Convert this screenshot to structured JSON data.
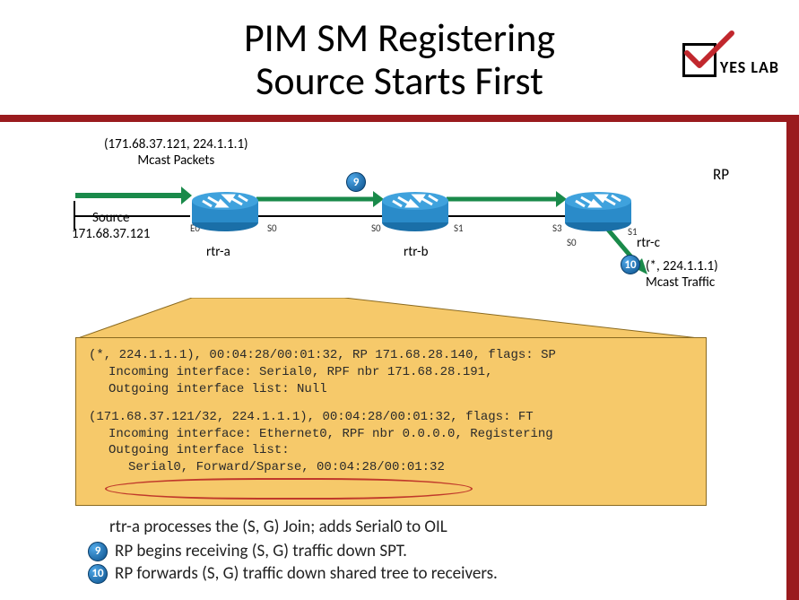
{
  "title_line1": "PIM SM Registering",
  "title_line2": "Source Starts First",
  "logo_text": "YES LAB",
  "diagram": {
    "packets_label_line1": "(171.68.37.121, 224.1.1.1)",
    "packets_label_line2": "Mcast Packets",
    "source_label_line1": "Source",
    "source_label_line2": "171.68.37.121",
    "rp_label": "RP",
    "rtr_a": "rtr-a",
    "rtr_b": "rtr-b",
    "rtr_c": "rtr-c",
    "mcast_label_line1": "(*, 224.1.1.1)",
    "mcast_label_line2": "Mcast Traffic",
    "iface_e0": "E0",
    "iface_s0a": "S0",
    "iface_s0b": "S0",
    "iface_s1b": "S1",
    "iface_s3c": "S3",
    "iface_s0c": "S0",
    "iface_s1c": "S1",
    "num9": "9",
    "num10": "10"
  },
  "cli": {
    "l1": "(*, 224.1.1.1), 00:04:28/00:01:32, RP 171.68.28.140, flags: SP",
    "l2": "Incoming interface: Serial0, RPF nbr 171.68.28.191,",
    "l3": "Outgoing interface list: Null",
    "l4": "(171.68.37.121/32, 224.1.1.1), 00:04:28/00:01:32, flags: FT",
    "l5": "Incoming interface: Ethernet0, RPF nbr 0.0.0.0, Registering",
    "l6": "Outgoing interface list:",
    "l7": "Serial0, Forward/Sparse, 00:04:28/00:01:32"
  },
  "steps": {
    "s0": "rtr-a processes the (S, G) Join; adds Serial0 to OIL",
    "s9": "RP begins receiving (S, G) traffic down SPT.",
    "s10": "RP forwards (S, G) traffic down shared tree to receivers.",
    "n9": "9",
    "n10": "10"
  }
}
